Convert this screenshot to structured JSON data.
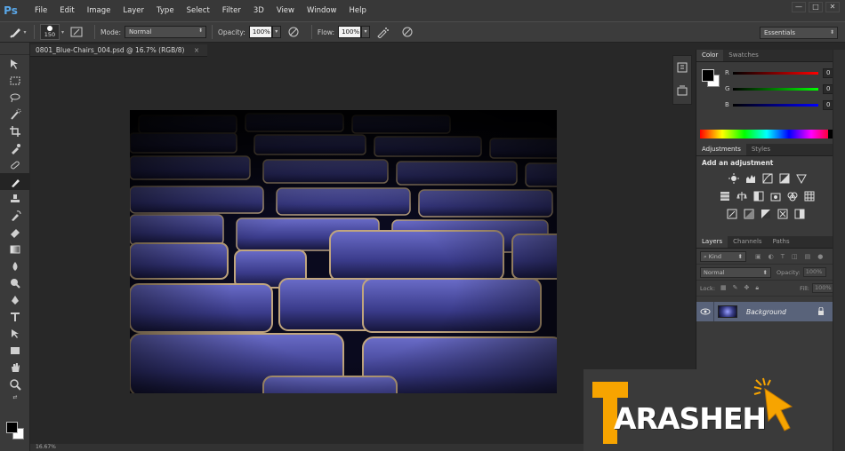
{
  "app": {
    "logo": "Ps",
    "menu": [
      "File",
      "Edit",
      "Image",
      "Layer",
      "Type",
      "Select",
      "Filter",
      "3D",
      "View",
      "Window",
      "Help"
    ],
    "window_controls": [
      "—",
      "□",
      "✕"
    ]
  },
  "options_bar": {
    "brush_size": "150",
    "mode_label": "Mode:",
    "mode_value": "Normal",
    "opacity_label": "Opacity:",
    "opacity_value": "100%",
    "flow_label": "Flow:",
    "flow_value": "100%",
    "workspace": "Essentials"
  },
  "document": {
    "tab_title": "0801_Blue-Chairs_004.psd @ 16.7% (RGB/8)",
    "close": "×"
  },
  "status": {
    "zoom": "16.67%"
  },
  "color_panel": {
    "tabs": [
      "Color",
      "Swatches"
    ],
    "channels": [
      {
        "label": "R",
        "value": "0",
        "color": "#e03030"
      },
      {
        "label": "G",
        "value": "0",
        "color": "#30c040"
      },
      {
        "label": "B",
        "value": "0",
        "color": "#3050e0"
      }
    ]
  },
  "adjustments_panel": {
    "tabs": [
      "Adjustments",
      "Styles"
    ],
    "title": "Add an adjustment"
  },
  "layers_panel": {
    "tabs": [
      "Layers",
      "Channels",
      "Paths"
    ],
    "kind": "Kind",
    "blend_mode": "Normal",
    "opacity_label": "Opacity:",
    "opacity_value": "100%",
    "lock_label": "Lock:",
    "fill_label": "Fill:",
    "fill_value": "100%",
    "layers": [
      {
        "name": "Background"
      }
    ]
  },
  "watermark": {
    "text": "ARASHEH",
    "letter": "T",
    "accent_color": "#f7a400"
  }
}
